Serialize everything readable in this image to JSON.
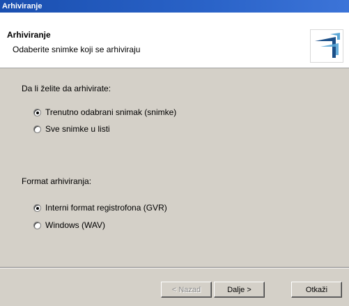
{
  "window": {
    "title": "Arhiviranje"
  },
  "header": {
    "title": "Arhiviranje",
    "subtitle": "Odaberite snimke koji se arhiviraju"
  },
  "section1": {
    "label": "Da li želite da arhivirate:",
    "options": [
      {
        "label": "Trenutno odabrani snimak (snimke)",
        "checked": true
      },
      {
        "label": "Sve snimke u listi",
        "checked": false
      }
    ]
  },
  "section2": {
    "label": "Format arhiviranja:",
    "options": [
      {
        "label": "Interni format registrofona (GVR)",
        "checked": true
      },
      {
        "label": "Windows (WAV)",
        "checked": false
      }
    ]
  },
  "buttons": {
    "back": "< Nazad",
    "next": "Dalje >",
    "cancel": "Otkaži"
  },
  "colors": {
    "titlebar": "#2a63c8",
    "logo_dark": "#1c4f88",
    "logo_light": "#5aa6d6"
  }
}
